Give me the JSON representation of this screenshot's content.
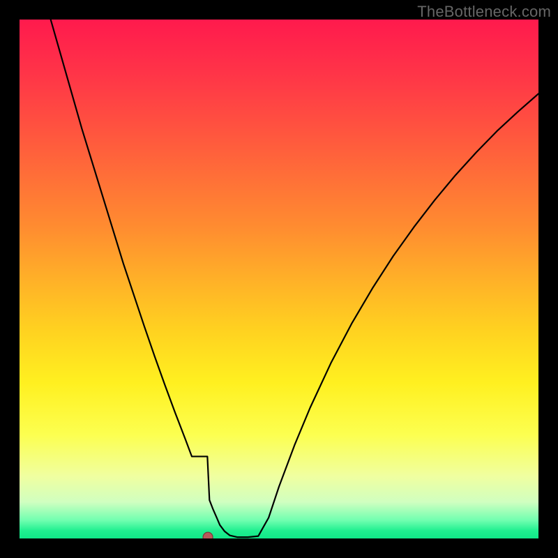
{
  "watermark": "TheBottleneck.com",
  "colors": {
    "frame": "#000000",
    "curve": "#000000",
    "dot_fill": "#b85a5a",
    "dot_stroke": "#7a3a3a",
    "gradient_stops": [
      {
        "offset": 0.0,
        "color": "#ff1a4d"
      },
      {
        "offset": 0.1,
        "color": "#ff3348"
      },
      {
        "offset": 0.2,
        "color": "#ff5040"
      },
      {
        "offset": 0.3,
        "color": "#ff6e38"
      },
      {
        "offset": 0.4,
        "color": "#ff8c30"
      },
      {
        "offset": 0.5,
        "color": "#ffb028"
      },
      {
        "offset": 0.6,
        "color": "#ffd220"
      },
      {
        "offset": 0.7,
        "color": "#fff020"
      },
      {
        "offset": 0.8,
        "color": "#fcff50"
      },
      {
        "offset": 0.88,
        "color": "#f0ffa0"
      },
      {
        "offset": 0.93,
        "color": "#d0ffc0"
      },
      {
        "offset": 0.965,
        "color": "#70ffb0"
      },
      {
        "offset": 0.985,
        "color": "#20f090"
      },
      {
        "offset": 1.0,
        "color": "#10e888"
      }
    ]
  },
  "chart_data": {
    "type": "line",
    "title": "",
    "xlabel": "",
    "ylabel": "",
    "xlim": [
      0,
      100
    ],
    "ylim": [
      0,
      100
    ],
    "series": [
      {
        "name": "curve",
        "x": [
          6,
          8,
          10,
          12,
          14,
          16,
          18,
          20,
          22,
          24,
          26,
          28,
          30,
          32,
          33.2,
          34.8,
          35.7,
          36.6,
          37.3,
          38.0,
          38.6,
          39.5,
          40.5,
          42,
          44,
          46,
          48,
          50,
          53,
          56,
          60,
          64,
          68,
          72,
          76,
          80,
          84,
          88,
          92,
          96,
          100
        ],
        "y": [
          100,
          93,
          86,
          79,
          72.5,
          66,
          59.5,
          53,
          47,
          41,
          35.2,
          29.6,
          24.2,
          19,
          15.8,
          11.8,
          9.6,
          7.4,
          5.6,
          4.0,
          2.6,
          1.4,
          0.6,
          0.25,
          0.25,
          0.45,
          4.0,
          10.0,
          18.0,
          25.2,
          33.8,
          41.4,
          48.2,
          54.4,
          60.0,
          65.2,
          70.0,
          74.4,
          78.5,
          82.2,
          85.7
        ]
      }
    ],
    "trough_flat_x": [
      33.4,
      36.2
    ],
    "marker": {
      "x": 36.3,
      "y": 0.25
    }
  }
}
